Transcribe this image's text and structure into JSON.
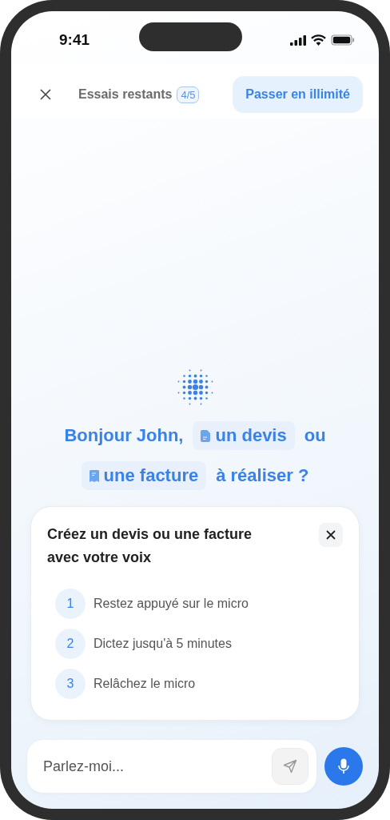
{
  "status_bar": {
    "time": "9:41"
  },
  "header": {
    "trials_label": "Essais restants",
    "trials_count": "4/5",
    "upgrade_button": "Passer en illimité"
  },
  "greeting": {
    "lines": [
      [
        {
          "kind": "text",
          "text": "Bonjour John,"
        },
        {
          "kind": "quote_chip",
          "text": "un devis"
        },
        {
          "kind": "text",
          "text": "ou"
        }
      ],
      [
        {
          "kind": "invoice_chip",
          "text": "une facture"
        },
        {
          "kind": "text",
          "text": "à réaliser ?"
        }
      ]
    ]
  },
  "tips_card": {
    "title": "Créez un devis ou une facture avec votre voix",
    "steps": [
      {
        "number": "1",
        "text": "Restez appuyé sur le micro"
      },
      {
        "number": "2",
        "text": "Dictez jusqu'à 5 minutes"
      },
      {
        "number": "3",
        "text": "Relâchez le micro"
      }
    ]
  },
  "composer": {
    "placeholder": "Parlez-moi..."
  }
}
